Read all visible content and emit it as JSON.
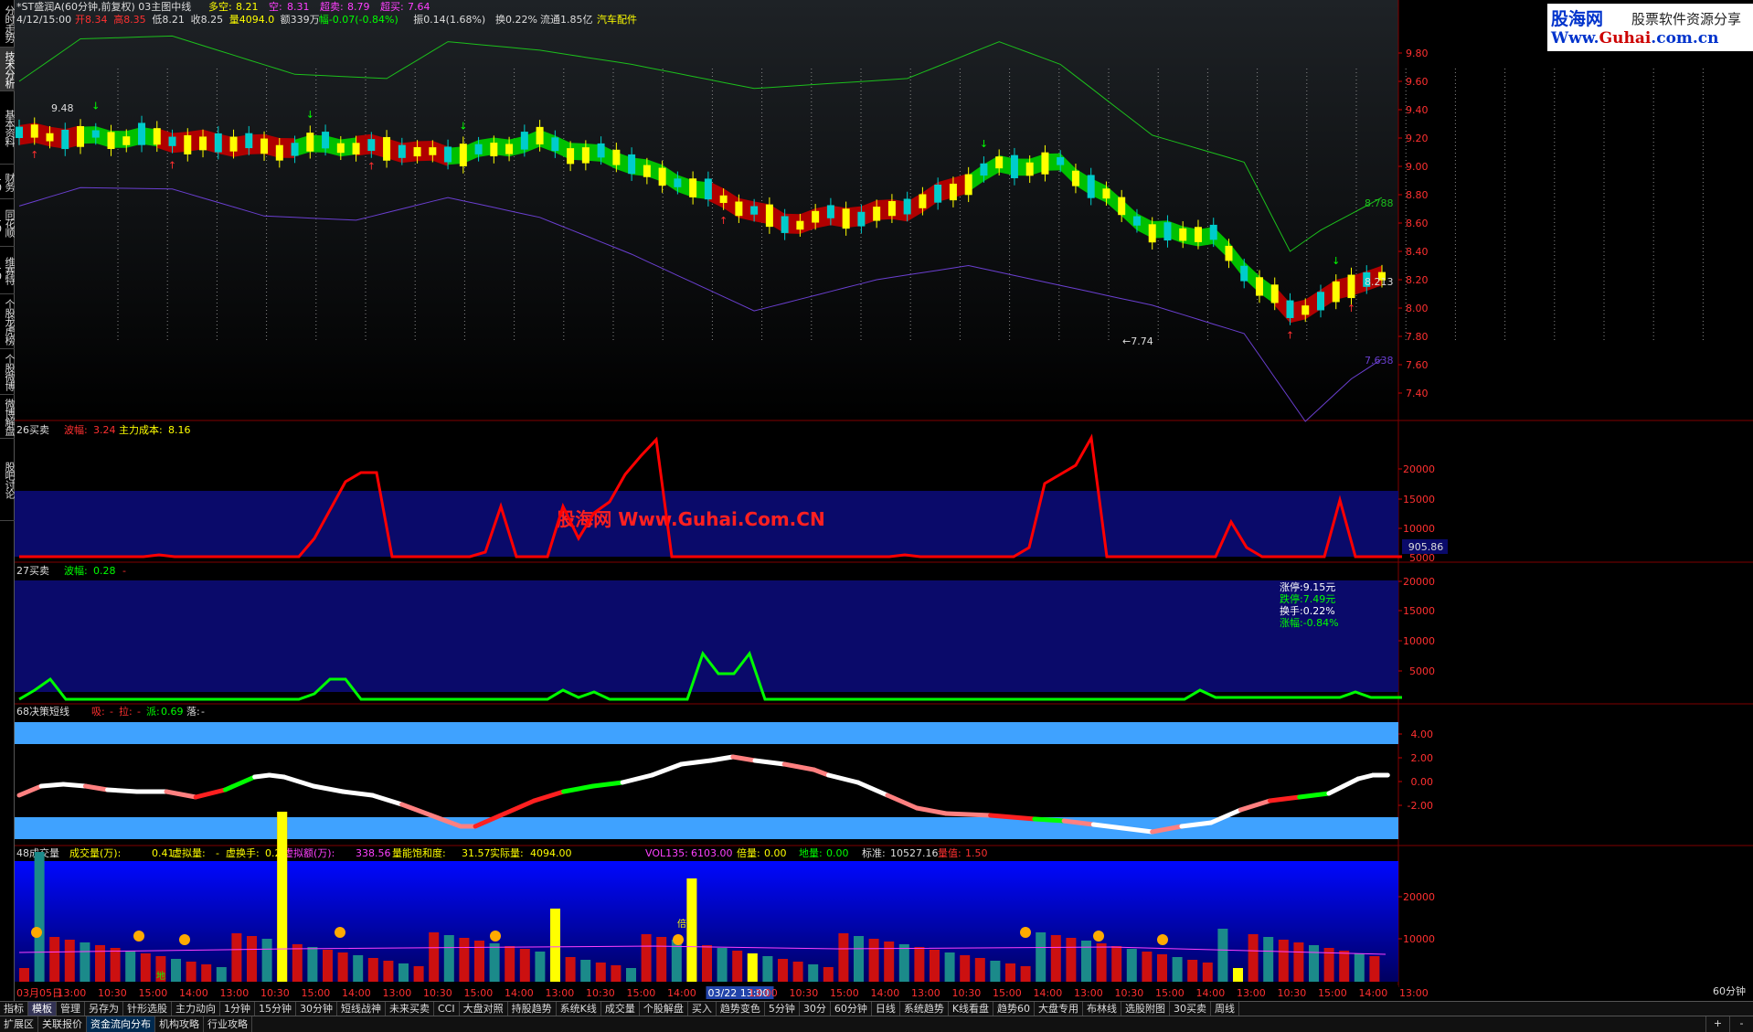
{
  "stock": {
    "name": "*ST盛润A(60分钟,前复权) 03主图中线",
    "duokong_label": "多空:",
    "duokong": "8.21",
    "kong_label": "空:",
    "kong": "8.31",
    "chaomai_label": "超卖:",
    "chaomai": "8.79",
    "chaomai2_label": "超买:",
    "chaomai2": "7.64",
    "date": "4/12/15:00",
    "open_label": "开",
    "open": "8.34",
    "high_label": "高",
    "high": "8.35",
    "low_label": "低",
    "low": "8.21",
    "close_label": "收",
    "close": "8.25",
    "vol_label": "量",
    "vol": "4094.0",
    "amount_label": "额",
    "amount": "339万",
    "change_label": "幅",
    "change": "-0.07(-0.84%)",
    "amp_label": "振",
    "amp": "0.14(1.68%)",
    "turnover_label": "换",
    "turnover": "0.22%",
    "float_label": "流通",
    "float": "1.85亿",
    "sector": "汽车配件"
  },
  "brand": {
    "title": "股海网",
    "slogan": "股票软件资源分享",
    "url_pre": "Www.",
    "url_main": "Guhai",
    "url_post": ".com.cn"
  },
  "watermark": "股海网 Www.Guhai.Com.CN",
  "left_tabs": [
    "分时走势",
    "技术分析",
    "基本资料",
    "财务10",
    "同花顺10",
    "维赛特10",
    "个股龙虎榜",
    "个股微博",
    "微博解盘",
    "股吧讨论"
  ],
  "main_chart": {
    "y_ticks": [
      "9.80",
      "9.60",
      "9.40",
      "9.20",
      "9.00",
      "8.80",
      "8.60",
      "8.40",
      "8.20",
      "8.00",
      "7.80",
      "7.60",
      "7.40"
    ],
    "ann_high": "9.48",
    "ann_low": "7.74",
    "upper_band_value": "8.788",
    "mid_value": "8.213",
    "lower_band_value": "7.638"
  },
  "panel1": {
    "title": "26买卖",
    "l1": "波幅:",
    "v1": "3.24",
    "l2": "主力成本:",
    "v2": "8.16",
    "y_ticks": [
      "20000",
      "15000",
      "10000",
      "5000"
    ],
    "corner": "905.86"
  },
  "panel2": {
    "title": "27买卖",
    "l1": "波幅:",
    "v1": "0.28",
    "v2": "-",
    "y_ticks": [
      "20000",
      "15000",
      "10000",
      "5000"
    ],
    "info": [
      "涨停:9.15元",
      "跌停:7.49元",
      "换手:0.22%",
      "涨幅:-0.84%"
    ]
  },
  "panel3": {
    "title": "68决策短线",
    "l1": "吸:",
    "v1": "-",
    "l2": "拉:",
    "v2": "-",
    "l3": "派:",
    "v3": "0.69",
    "l4": "落:",
    "v4": "-",
    "y_ticks": [
      "4.00",
      "2.00",
      "0.00",
      "-2.00"
    ]
  },
  "panel4": {
    "title": "48成交量",
    "l1": "成交量(万):",
    "v1": "0.41",
    "l2": "虚拟量:",
    "v2": "-",
    "l3": "虚换手:",
    "v3": "0.22",
    "l4": "虚拟额(万):",
    "v4": "338.56",
    "l5": "量能饱和度:",
    "v5": "31.57",
    "l6": "实际量:",
    "v6": "4094.00",
    "l7": "VOL135:",
    "v7": "6103.00",
    "l8": "倍量:",
    "v8": "0.00",
    "l9": "地量:",
    "v9": "0.00",
    "l10": "标准:",
    "v10": "10527.16",
    "l11": "量值:",
    "v11": "1.50",
    "y_ticks": [
      "20000",
      "10000"
    ],
    "bei": "倍",
    "di": "地"
  },
  "time_axis": [
    "03月05日",
    "13:00",
    "10:30",
    "15:00",
    "14:00",
    "13:00",
    "10:30",
    "15:00",
    "14:00",
    "13:00",
    "10:30",
    "15:00",
    "14:00",
    "13:00",
    "10:30",
    "15:00",
    "14:00",
    "03/22 13:00",
    "13:00",
    "10:30",
    "15:00",
    "14:00",
    "13:00",
    "10:30",
    "15:00",
    "14:00",
    "13:00",
    "10:30",
    "15:00",
    "14:00",
    "13:00",
    "10:30",
    "15:00",
    "14:00",
    "13:00"
  ],
  "timeframe": "60分钟",
  "bottom_tabs": [
    "指标",
    "模板",
    "管理",
    "另存为",
    "针形选股",
    "主力动向",
    "1分钟",
    "15分钟",
    "30分钟",
    "短线战神",
    "未来买卖",
    "CCI",
    "大盘对照",
    "持股趋势",
    "系统K线",
    "成交量",
    "个股解盘",
    "买入",
    "趋势变色",
    "5分钟",
    "30分",
    "60分钟",
    "日线",
    "系统趋势",
    "K线看盘",
    "趋势60",
    "大盘专用",
    "布林线",
    "选股附图",
    "30买卖",
    "周线"
  ],
  "bottom_tabs2": [
    "扩展区",
    "关联报价",
    "资金流向分布",
    "机构攻略",
    "行业攻略"
  ],
  "bottom_right": [
    "+",
    "-"
  ],
  "colors": {
    "up": "#ffff00",
    "down": "#00cccc",
    "red": "#ff2020",
    "green": "#00ff00",
    "panelblue": "#0a0a6a"
  }
}
